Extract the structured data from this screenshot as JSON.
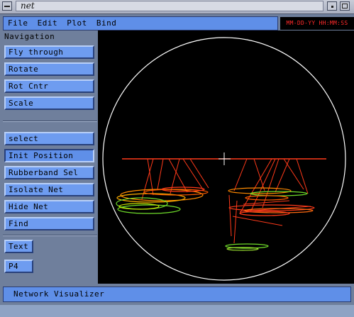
{
  "window": {
    "title": "net"
  },
  "menubar": {
    "items": [
      "File",
      "Edit",
      "Plot",
      "Bind"
    ]
  },
  "stamp": "MM-DD-YY HH:MM:SS",
  "navigation": {
    "label": "Navigation",
    "group1": [
      "Fly through",
      "Rotate",
      "Rot Cntr",
      "Scale"
    ],
    "group2": [
      "select",
      "Init Position",
      "Rubberband Sel",
      "Isolate Net",
      "Hide Net",
      "Find"
    ],
    "group3": [
      "Text",
      "P4"
    ]
  },
  "status": {
    "text": "Network Visualizer"
  },
  "colors": {
    "panel": "#6f7f9c",
    "button": "#6e9cf0",
    "net_red": "#ff3a1a",
    "net_orange": "#ff8a00",
    "net_green": "#6fdc2a"
  }
}
